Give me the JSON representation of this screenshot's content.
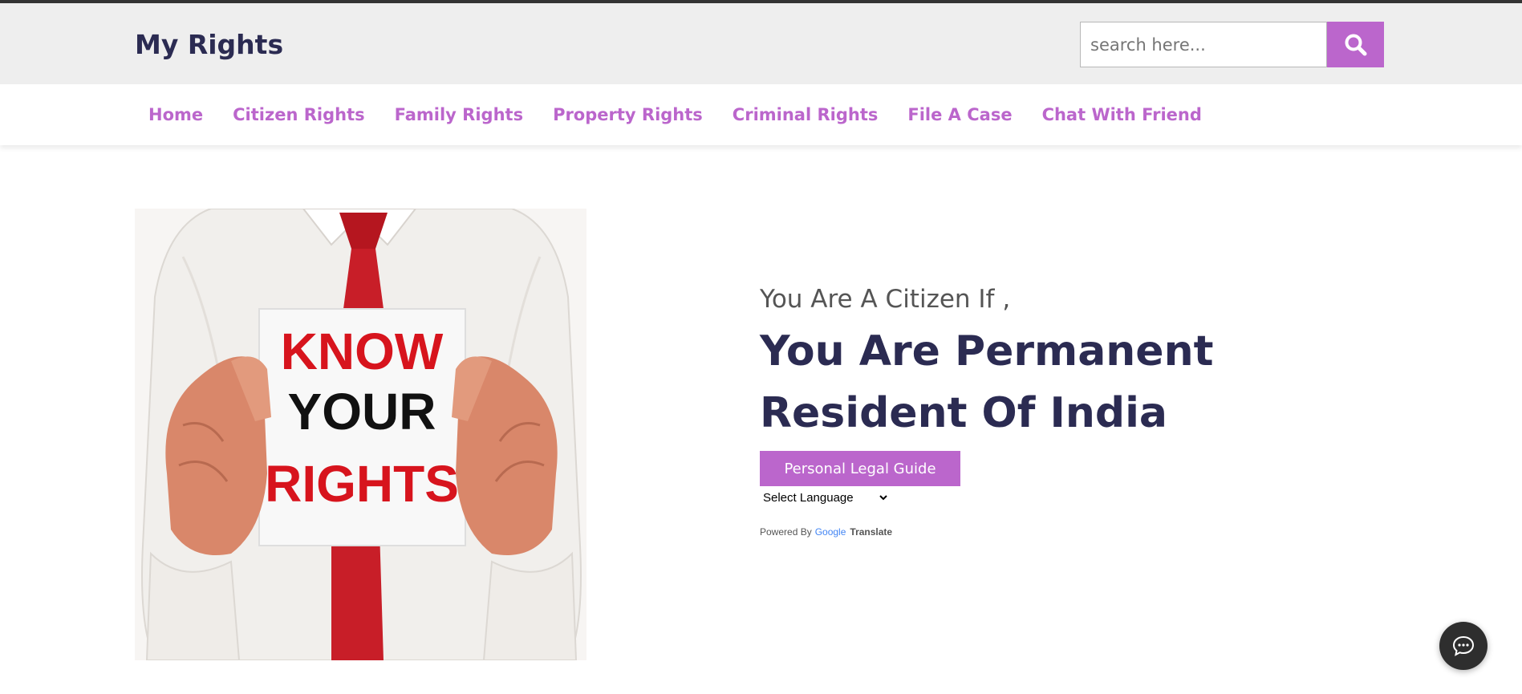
{
  "site": {
    "brand": "My Rights"
  },
  "search": {
    "placeholder": "search here..."
  },
  "nav": {
    "items": [
      {
        "label": "Home"
      },
      {
        "label": "Citizen Rights"
      },
      {
        "label": "Family Rights"
      },
      {
        "label": "Property Rights"
      },
      {
        "label": "Criminal Rights"
      },
      {
        "label": "File A Case"
      },
      {
        "label": "Chat With Friend"
      }
    ]
  },
  "hero": {
    "sign_lines": [
      "KNOW",
      "YOUR",
      "RIGHTS"
    ],
    "subtitle": "You Are A Citizen If ,",
    "title": "You Are Permanent Resident Of India",
    "button_label": "Personal Legal Guide"
  },
  "translate": {
    "select_label": "Select Language",
    "powered_by": "Powered By",
    "google": "Google",
    "translate": "Translate"
  },
  "colors": {
    "accent": "#bb66cc",
    "brand_text": "#2b2b52",
    "header_bg": "#eeeeee",
    "sign_red": "#d7141d",
    "tie_red": "#c81e28"
  },
  "icons": {
    "search": "search-icon",
    "chat": "chat-bubble-icon"
  }
}
